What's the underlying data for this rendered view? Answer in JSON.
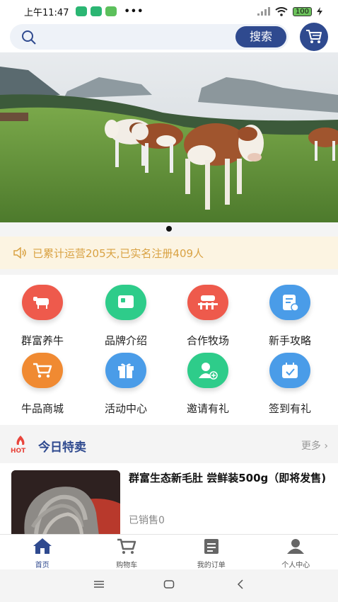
{
  "status_bar": {
    "time": "上午11:47",
    "more": "•••",
    "battery": "100"
  },
  "search": {
    "placeholder": "",
    "button_label": "搜索"
  },
  "notice": {
    "text": "已累计运营205天,已实名注册409人"
  },
  "grid": [
    {
      "label": "群富养牛",
      "icon": "cow-icon",
      "color": "#ee5a4c"
    },
    {
      "label": "品牌介绍",
      "icon": "brand-icon",
      "color": "#2ecc8a"
    },
    {
      "label": "合作牧场",
      "icon": "ranch-icon",
      "color": "#ee5a4c"
    },
    {
      "label": "新手攻略",
      "icon": "guide-icon",
      "color": "#4a9ce8"
    },
    {
      "label": "牛品商城",
      "icon": "shop-cart-icon",
      "color": "#f08a32"
    },
    {
      "label": "活动中心",
      "icon": "gift-icon",
      "color": "#4a9ce8"
    },
    {
      "label": "邀请有礼",
      "icon": "invite-icon",
      "color": "#2ecc8a"
    },
    {
      "label": "签到有礼",
      "icon": "calendar-icon",
      "color": "#4a9ce8"
    }
  ],
  "section": {
    "badge": "HOT",
    "title": "今日特卖",
    "more": "更多"
  },
  "product": {
    "name": "群富生态新毛肚 尝鲜装500g（即将发售)",
    "sold": "已销售0"
  },
  "tabs": [
    {
      "label": "首页",
      "icon": "home-icon",
      "active": true
    },
    {
      "label": "购物车",
      "icon": "cart-icon",
      "active": false
    },
    {
      "label": "我的订单",
      "icon": "orders-icon",
      "active": false
    },
    {
      "label": "个人中心",
      "icon": "profile-icon",
      "active": false
    }
  ],
  "colors": {
    "brand": "#2f4a8f",
    "notice_text": "#d9a243",
    "notice_bg": "#fcf4e2"
  }
}
